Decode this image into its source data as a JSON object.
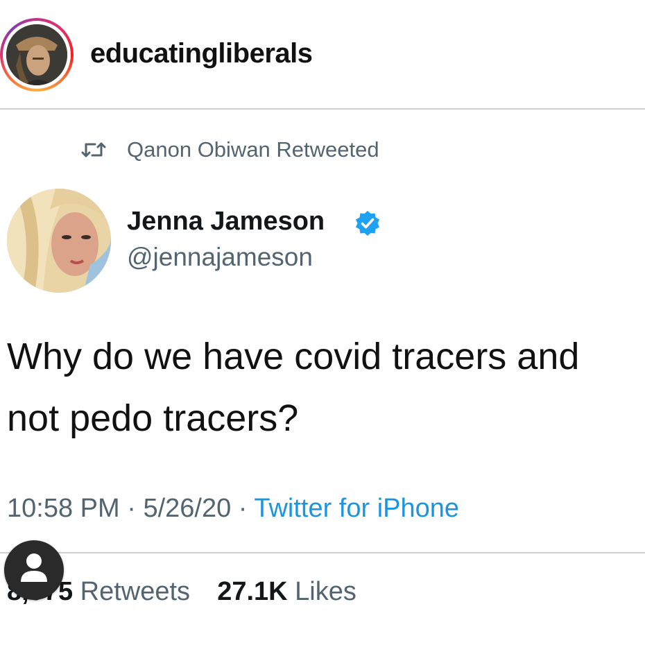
{
  "instagram": {
    "username": "educatingliberals"
  },
  "tweet": {
    "retweeted_by": "Qanon Obiwan Retweeted",
    "author_name": "Jenna Jameson",
    "author_handle": "@jennajameson",
    "text_line1": "Why do we have covid tracers and",
    "text_line2": "not pedo tracers?",
    "time": "10:58 PM",
    "date": "5/26/20",
    "source": "Twitter for iPhone",
    "retweet_count": "8,975",
    "retweet_label": "Retweets",
    "like_count": "27.1K",
    "like_label": "Likes"
  },
  "colors": {
    "link_blue": "#1b95e0",
    "secondary_gray": "#536471",
    "verified_blue": "#1da1f2"
  },
  "icons": [
    "retweet-icon",
    "verified-badge-icon",
    "user-profile-icon"
  ]
}
